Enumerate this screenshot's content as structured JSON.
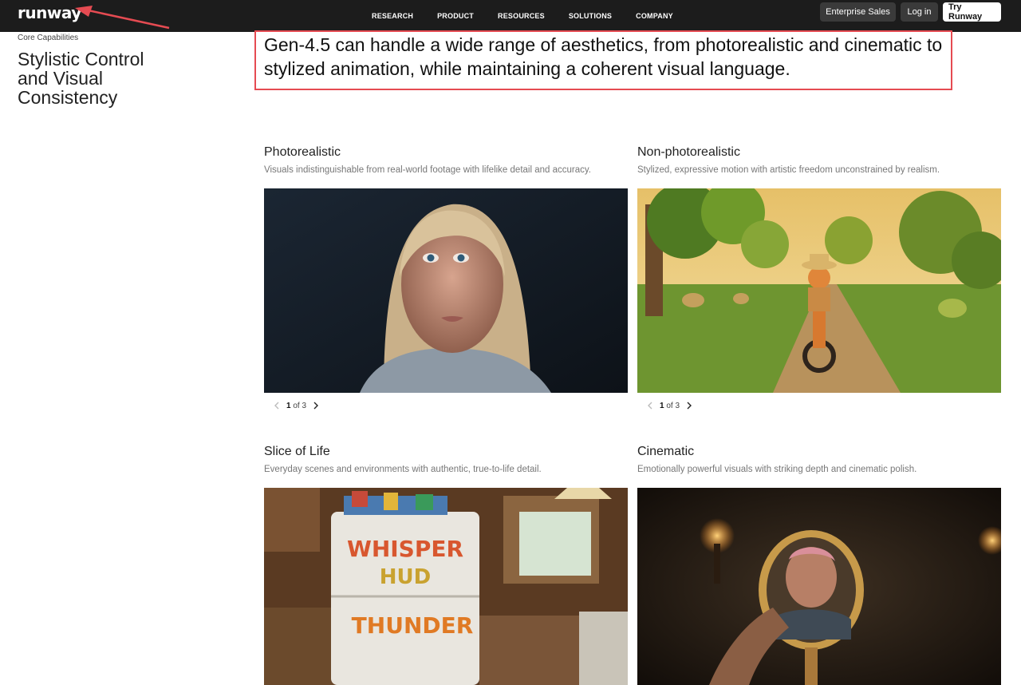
{
  "header": {
    "logo": "runway",
    "nav": [
      "RESEARCH",
      "PRODUCT",
      "RESOURCES",
      "SOLUTIONS",
      "COMPANY"
    ],
    "enterprise_label": "Enterprise Sales",
    "login_label": "Log in",
    "try_label": "Try Runway"
  },
  "sidebar": {
    "eyebrow": "Core Capabilities",
    "title": "Stylistic Control and Visual Consistency"
  },
  "headline": "Gen-4.5 can handle a wide range of aesthetics, from photorealistic and cinematic to stylized animation, while maintaining a coherent visual language.",
  "annotation_color": "#e54b52",
  "cards": [
    {
      "title": "Photorealistic",
      "desc": "Visuals indistinguishable from real-world footage with lifelike detail and accuracy.",
      "pager_current": "1",
      "pager_rest": " of 3"
    },
    {
      "title": "Non-photorealistic",
      "desc": "Stylized, expressive motion with artistic freedom unconstrained by realism.",
      "pager_current": "1",
      "pager_rest": " of 3"
    },
    {
      "title": "Slice of Life",
      "desc": "Everyday scenes and environments with authentic, true-to-life detail."
    },
    {
      "title": "Cinematic",
      "desc": "Emotionally powerful visuals with striking depth and cinematic polish."
    }
  ],
  "fridge_magnets": [
    "WHISPER",
    "HUD",
    "THUNDER"
  ],
  "icons": [
    "arrow-annotation-icon",
    "chevron-left-icon",
    "chevron-right-icon"
  ]
}
